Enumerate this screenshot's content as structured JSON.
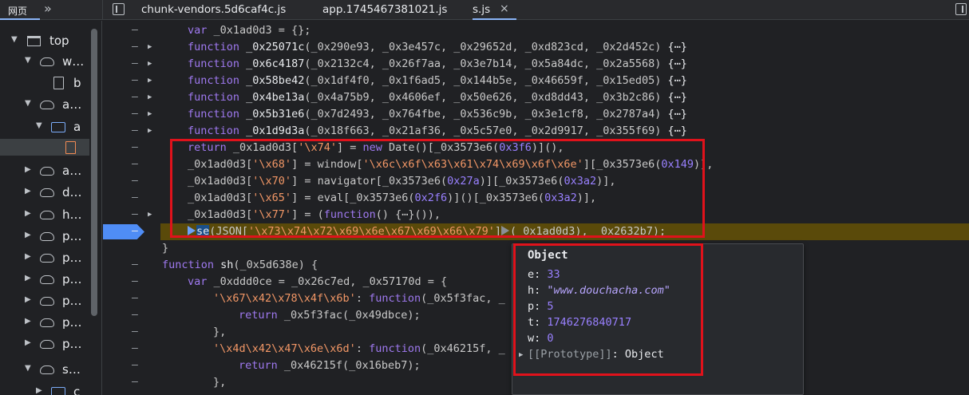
{
  "tabbar": {
    "nav_web": "网页",
    "more": "»",
    "tabs": [
      {
        "label": "chunk-vendors.5d6caf4c.js"
      },
      {
        "label": "app.1745467381021.js"
      },
      {
        "label": "s.js",
        "close": "×"
      }
    ]
  },
  "sidebar": {
    "items": [
      {
        "label": "top",
        "icon": "frame-icon"
      },
      {
        "label": "w…",
        "icon": "cloud-icon"
      },
      {
        "label": "b",
        "icon": "file-icon"
      },
      {
        "label": "a…",
        "icon": "cloud-icon"
      },
      {
        "label": "a",
        "icon": "folder-icon"
      },
      {
        "label": "",
        "icon": "file-icon"
      },
      {
        "label": "a…",
        "icon": "cloud-icon"
      },
      {
        "label": "d…",
        "icon": "cloud-icon"
      },
      {
        "label": "h…",
        "icon": "cloud-icon"
      },
      {
        "label": "p…",
        "icon": "cloud-icon"
      },
      {
        "label": "p…",
        "icon": "cloud-icon"
      },
      {
        "label": "p…",
        "icon": "cloud-icon"
      },
      {
        "label": "p…",
        "icon": "cloud-icon"
      },
      {
        "label": "p…",
        "icon": "cloud-icon"
      },
      {
        "label": "p…",
        "icon": "cloud-icon"
      },
      {
        "label": "s…",
        "icon": "cloud-icon"
      },
      {
        "label": "c",
        "icon": "folder-icon"
      }
    ]
  },
  "editor": {
    "gutter_dash": "–",
    "code": {
      "l0": {
        "kw": "var",
        "rest": " _0x1ad0d3 = {};"
      },
      "fns": [
        {
          "name": "_0x25071c",
          "args": "(_0x290e93, _0x3e457c, _0x29652d, _0xd823cd, _0x2d452c)",
          "tail": " {⋯}"
        },
        {
          "name": "_0x6c4187",
          "args": "(_0x2132c4, _0x26f7aa, _0x3e7b14, _0x5a84dc, _0x2a5568)",
          "tail": " {⋯}"
        },
        {
          "name": "_0x58be42",
          "args": "(_0x1df4f0, _0x1f6ad5, _0x144b5e, _0x46659f, _0x15ed05)",
          "tail": " {⋯}"
        },
        {
          "name": "_0x4be13a",
          "args": "(_0x4a75b9, _0x4606ef, _0x50e626, _0xd8dd43, _0x3b2c86)",
          "tail": " {⋯}"
        },
        {
          "name": "_0x5b31e6",
          "args": "(_0x7d2493, _0x764fbe, _0x536c9b, _0x3e1cf8, _0x2787a4)",
          "tail": " {⋯}"
        },
        {
          "name": "_0x1d9d3a",
          "args": "(_0x18f663, _0x21af36, _0x5c57e0, _0x2d9917, _0x355f69)",
          "tail": " {⋯}"
        }
      ],
      "function_kw": "function",
      "ret": {
        "kw": "return",
        "a": " _0x1ad0d3[",
        "s": "'\\x74'",
        "b": "] = ",
        "kw2": "new",
        "c": " Date()[_0x3573e6(",
        "n": "0x3f6",
        "d": ")](),"
      },
      "h": {
        "a": "_0x1ad0d3[",
        "s": "'\\x68'",
        "b": "] = window[",
        "s2": "'\\x6c\\x6f\\x63\\x61\\x74\\x69\\x6f\\x6e'",
        "c": "][_0x3573e6(",
        "n": "0x149",
        "d": ")],"
      },
      "p": {
        "a": "_0x1ad0d3[",
        "s": "'\\x70'",
        "b": "] = navigator[_0x3573e6(",
        "n": "0x27a",
        "c": ")][_0x3573e6(",
        "n2": "0x3a2",
        "d": ")],"
      },
      "e": {
        "a": "_0x1ad0d3[",
        "s": "'\\x65'",
        "b": "] = eval[_0x3573e6(",
        "n": "0x2f6",
        "c": ")]()[_0x3573e6(",
        "n2": "0x3a2",
        "d": ")],"
      },
      "w": {
        "a": "_0x1ad0d3[",
        "s": "'\\x77'",
        "b": "] = (",
        "kw": "function",
        "c": "() {⋯}()),"
      },
      "se": {
        "name": "se",
        "a": "(JSON[",
        "s": "'\\x73\\x74\\x72\\x69\\x6e\\x67\\x69\\x66\\x79'",
        "b": "]",
        "c": "(_0x1ad0d3), _0x2632b7);"
      },
      "close_brace": "}",
      "sh": {
        "kw": "function",
        "name": " sh",
        "args": "(_0x5d638e) {"
      },
      "var2": {
        "kw": "var",
        "rest": " _0xddd0ce = _0x26c7ed, _0x57170d = {"
      },
      "k1": {
        "s": "'\\x67\\x42\\x78\\x4f\\x6b'",
        "a": ": ",
        "kw": "function",
        "b": "(_0x5f3fac, _"
      },
      "r1": {
        "kw": "return",
        "rest": " _0x5f3fac(_0x49dbce);"
      },
      "c1": "},",
      "k2": {
        "s": "'\\x4d\\x42\\x47\\x6e\\x6d'",
        "a": ": ",
        "kw": "function",
        "b": "(_0x46215f, _"
      },
      "r2": {
        "kw": "return",
        "rest": " _0x46215f(_0x16beb7);"
      },
      "c2": "},"
    }
  },
  "popover": {
    "title": "Object",
    "props": [
      {
        "key": "e",
        "value": "33",
        "type": "number"
      },
      {
        "key": "h",
        "value": "\"www.douchacha.com\"",
        "type": "string"
      },
      {
        "key": "p",
        "value": "5",
        "type": "number"
      },
      {
        "key": "t",
        "value": "1746276840717",
        "type": "number"
      },
      {
        "key": "w",
        "value": "0",
        "type": "number"
      }
    ],
    "proto_key": "[[Prototype]]",
    "proto_value": ": Object"
  },
  "colors": {
    "highlight_box": "#e0121b",
    "paused_line": "#5a4a0a",
    "breakpoint": "#4f8df6"
  }
}
